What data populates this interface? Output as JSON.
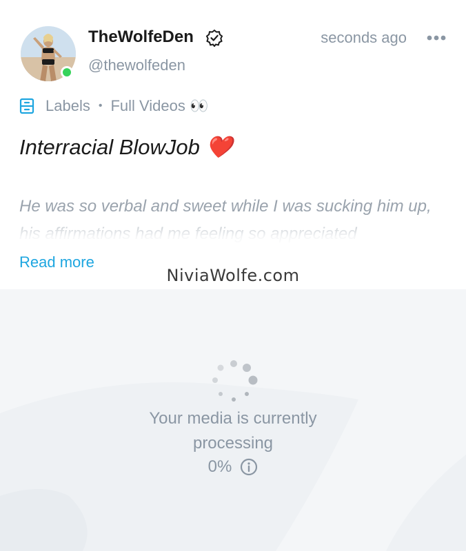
{
  "post": {
    "author_name": "TheWolfeDen",
    "author_handle": "@thewolfeden",
    "timestamp": "seconds ago",
    "labels_link": "Labels",
    "label_tag": "Full Videos 👀",
    "title": "Interracial BlowJob ❤️",
    "body": "He was so verbal and sweet while I was sucking him up, his affirmations had me feeling so appreciated",
    "read_more": "Read more",
    "online_status_color": "#36d35a",
    "verified": true
  },
  "watermark": "NiviaWolfe.com",
  "media": {
    "status_text": "Your media is currently processing",
    "progress_label": "0%",
    "progress": 0
  },
  "icons": {
    "more": "more-horizontal-icon",
    "labels": "labels-icon",
    "verified": "verified-badge-icon",
    "info": "info-icon",
    "spinner": "loading-spinner-icon"
  },
  "colors": {
    "accent": "#1ea6e0",
    "muted": "#8a96a3",
    "media_bg": "#f4f6f8"
  }
}
